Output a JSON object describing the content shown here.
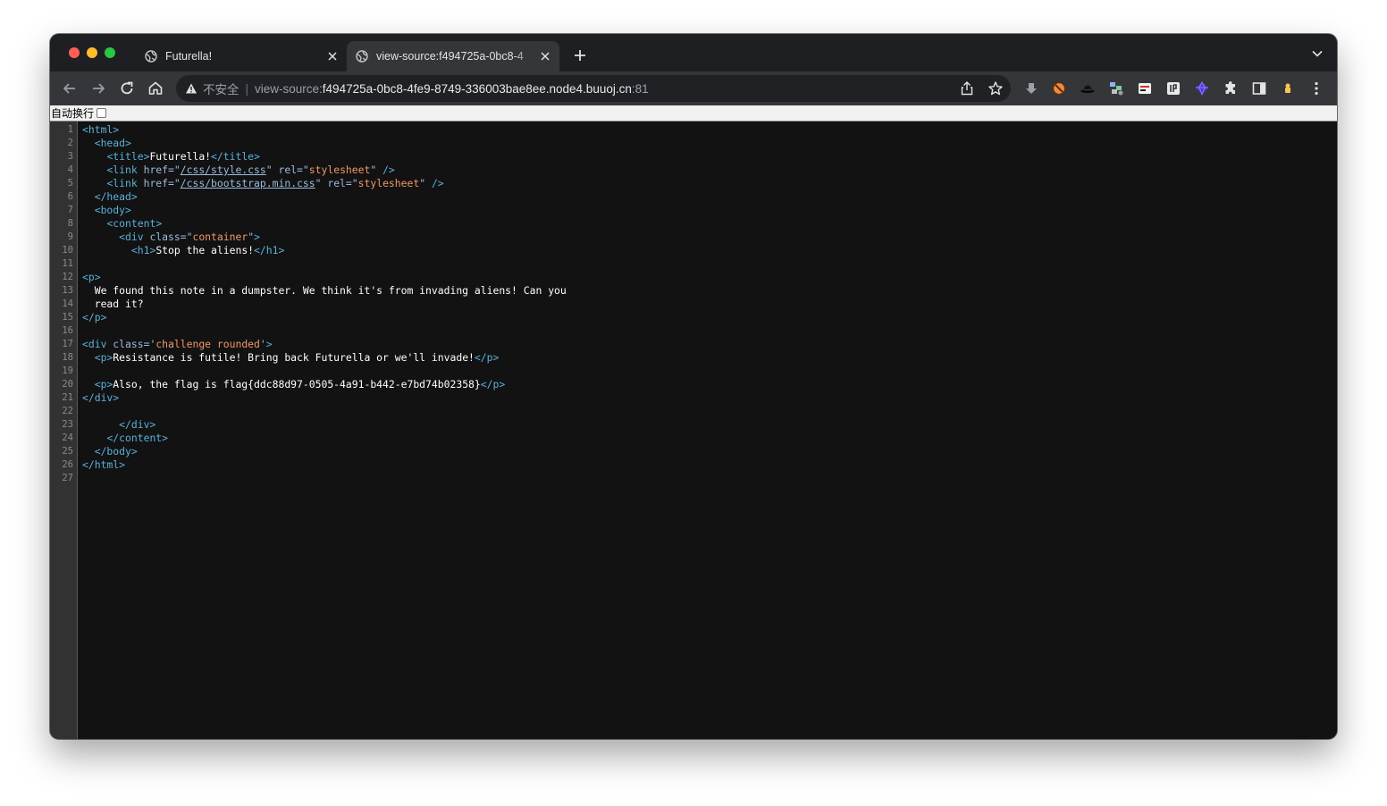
{
  "tabs": [
    {
      "title": "Futurella!",
      "active": false
    },
    {
      "title": "view-source:f494725a-0bc8-4",
      "active": true
    }
  ],
  "omnibox": {
    "security_label": "不安全",
    "scheme": "view-source:",
    "host": "f494725a-0bc8-4fe9-8749-336003bae8ee.node4.buuoj.cn",
    "port": ":81"
  },
  "wrap_toggle": {
    "label": "自动换行",
    "checked": false
  },
  "colors": {
    "tag": "#5db0d7",
    "attribute": "#9bbbdc",
    "value": "#f29766",
    "text": "#ffffff"
  },
  "source_lines": [
    {
      "n": "1",
      "text": "<html>"
    },
    {
      "n": "2",
      "text": "  <head>"
    },
    {
      "n": "3",
      "text": "    <title>Futurella!</title>"
    },
    {
      "n": "4",
      "text": "    <link href=\"/css/style.css\" rel=\"stylesheet\" />"
    },
    {
      "n": "5",
      "text": "    <link href=\"/css/bootstrap.min.css\" rel=\"stylesheet\" />"
    },
    {
      "n": "6",
      "text": "  </head>"
    },
    {
      "n": "7",
      "text": "  <body>"
    },
    {
      "n": "8",
      "text": "    <content>"
    },
    {
      "n": "9",
      "text": "      <div class=\"container\">"
    },
    {
      "n": "10",
      "text": "        <h1>Stop the aliens!</h1>"
    },
    {
      "n": "11",
      "text": ""
    },
    {
      "n": "12",
      "text": "<p>"
    },
    {
      "n": "13",
      "text": "  We found this note in a dumpster. We think it's from invading aliens! Can you"
    },
    {
      "n": "14",
      "text": "  read it?"
    },
    {
      "n": "15",
      "text": "</p>"
    },
    {
      "n": "16",
      "text": ""
    },
    {
      "n": "17",
      "text": "<div class='challenge rounded'>"
    },
    {
      "n": "18",
      "text": "  <p>Resistance is futile! Bring back Futurella or we'll invade!</p>"
    },
    {
      "n": "19",
      "text": ""
    },
    {
      "n": "20",
      "text": "  <p>Also, the flag is flag{ddc88d97-0505-4a91-b442-e7bd74b02358}</p>"
    },
    {
      "n": "21",
      "text": "</div>"
    },
    {
      "n": "22",
      "text": ""
    },
    {
      "n": "23",
      "text": "      </div>"
    },
    {
      "n": "24",
      "text": "    </content>"
    },
    {
      "n": "25",
      "text": "  </body>"
    },
    {
      "n": "26",
      "text": "</html>"
    },
    {
      "n": "27",
      "text": ""
    }
  ]
}
